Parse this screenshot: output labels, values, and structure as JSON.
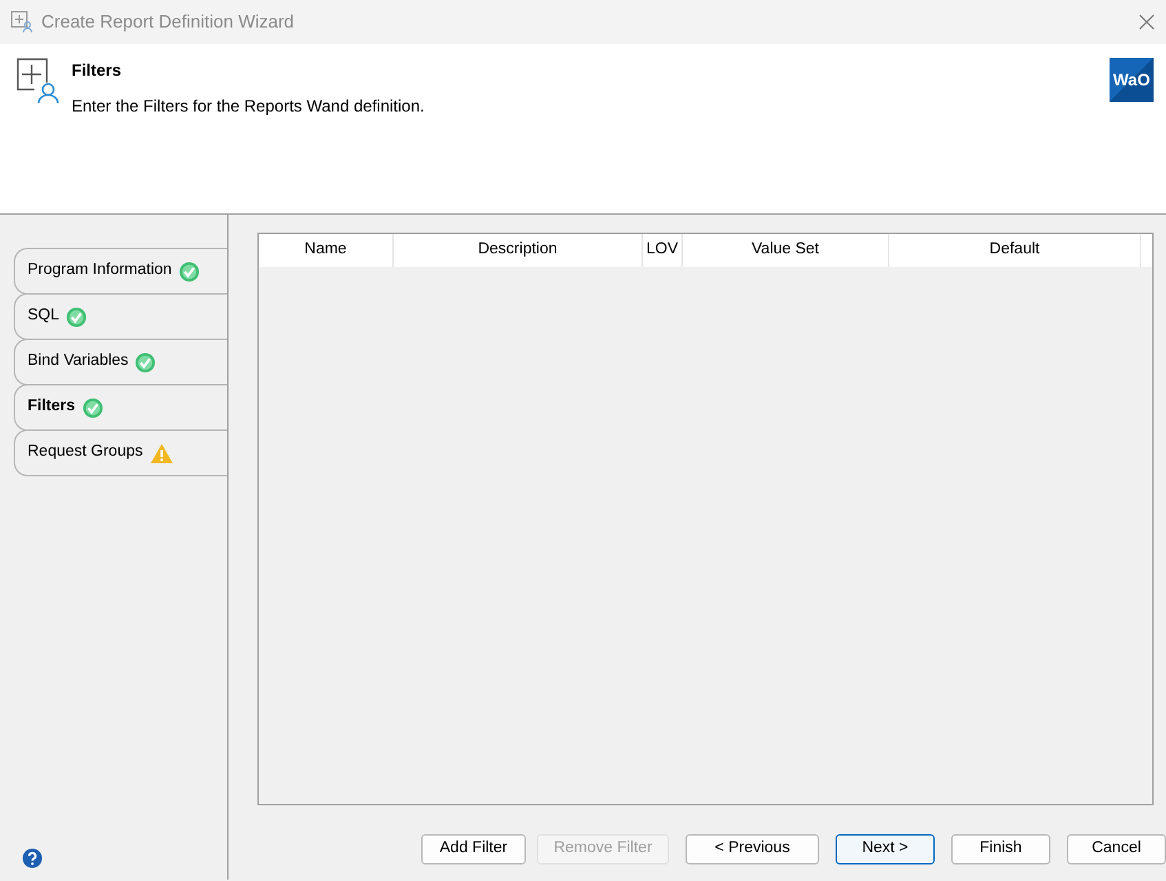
{
  "window": {
    "title": "Create Report Definition Wizard"
  },
  "header": {
    "title": "Filters",
    "subtitle": "Enter the Filters for the Reports Wand definition.",
    "logo_text": "WaO"
  },
  "steps": [
    {
      "label": "Program Information",
      "kind": "complete",
      "selected": false
    },
    {
      "label": "SQL",
      "kind": "complete",
      "selected": false
    },
    {
      "label": "Bind Variables",
      "kind": "complete",
      "selected": false
    },
    {
      "label": "Filters",
      "kind": "complete",
      "selected": true
    },
    {
      "label": "Request Groups",
      "kind": "warning",
      "selected": false
    }
  ],
  "table": {
    "columns": [
      "Name",
      "Description",
      "LOV",
      "Value Set",
      "Default"
    ]
  },
  "buttons": [
    {
      "label": "Add Filter",
      "disabled": false,
      "default": false
    },
    {
      "label": "Remove Filter",
      "disabled": true,
      "default": false
    },
    {
      "label": "< Previous",
      "disabled": false,
      "default": false
    },
    {
      "label": "Next >",
      "disabled": false,
      "default": true
    },
    {
      "label": "Finish",
      "disabled": false,
      "default": false
    },
    {
      "label": "Cancel",
      "disabled": false,
      "default": false
    }
  ]
}
